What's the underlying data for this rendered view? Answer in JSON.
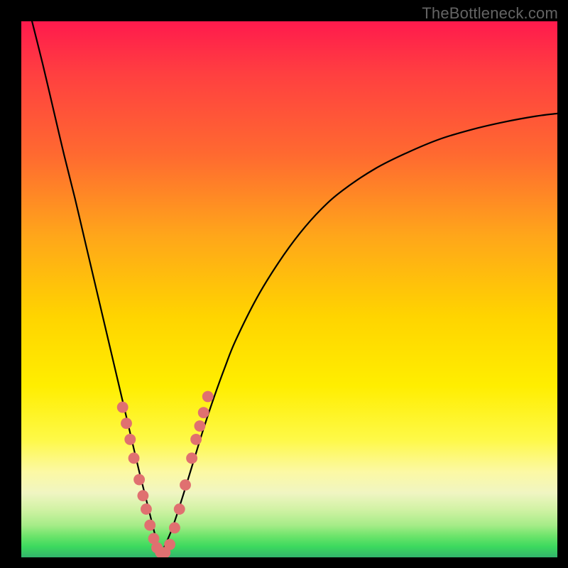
{
  "watermark": "TheBottleneck.com",
  "colors": {
    "frame": "#000000",
    "curve": "#000000",
    "marker_fill": "#e07070",
    "gradient_top": "#ff1a4d",
    "gradient_bottom": "#32b46c"
  },
  "chart_data": {
    "type": "line",
    "title": "",
    "xlabel": "",
    "ylabel": "",
    "xlim": [
      0,
      100
    ],
    "ylim": [
      0,
      100
    ],
    "grid": false,
    "note": "Axes have no visible tick labels; x and y are in 0–100 plot-area percentage coordinates. y=0 is bottom (green), y=100 is top (red). Two smooth curves meet near the bottom minimum around x≈26.",
    "series": [
      {
        "name": "left-descending-curve",
        "x": [
          0,
          2,
          4,
          6,
          8,
          10,
          12,
          14,
          16,
          18,
          20,
          22,
          24,
          25,
          26
        ],
        "y": [
          108,
          100,
          92,
          83.5,
          75,
          67,
          58.5,
          50,
          41.5,
          33,
          24.5,
          16,
          8,
          4,
          0.5
        ]
      },
      {
        "name": "right-ascending-curve",
        "x": [
          26,
          28,
          30,
          32,
          34,
          36,
          38,
          40,
          44,
          48,
          52,
          56,
          60,
          66,
          72,
          78,
          84,
          90,
          96,
          100
        ],
        "y": [
          0.5,
          5,
          11,
          17.5,
          24,
          30,
          35.5,
          40.5,
          48.5,
          55,
          60.5,
          65,
          68.5,
          72.5,
          75.5,
          78,
          79.8,
          81.2,
          82.3,
          82.8
        ]
      }
    ],
    "markers": {
      "name": "overlay-dots-near-minimum",
      "color": "#e07070",
      "radius_pct": 1.05,
      "points_xy": [
        [
          18.9,
          28.0
        ],
        [
          19.6,
          25.0
        ],
        [
          20.3,
          22.0
        ],
        [
          21.0,
          18.5
        ],
        [
          22.0,
          14.5
        ],
        [
          22.7,
          11.5
        ],
        [
          23.3,
          9.0
        ],
        [
          24.0,
          6.0
        ],
        [
          24.7,
          3.5
        ],
        [
          25.3,
          1.8
        ],
        [
          26.0,
          0.9
        ],
        [
          26.8,
          0.9
        ],
        [
          27.7,
          2.4
        ],
        [
          28.6,
          5.5
        ],
        [
          29.5,
          9.0
        ],
        [
          30.6,
          13.5
        ],
        [
          31.8,
          18.5
        ],
        [
          32.6,
          22.0
        ],
        [
          33.3,
          24.5
        ],
        [
          34.0,
          27.0
        ],
        [
          34.8,
          30.0
        ]
      ]
    }
  }
}
